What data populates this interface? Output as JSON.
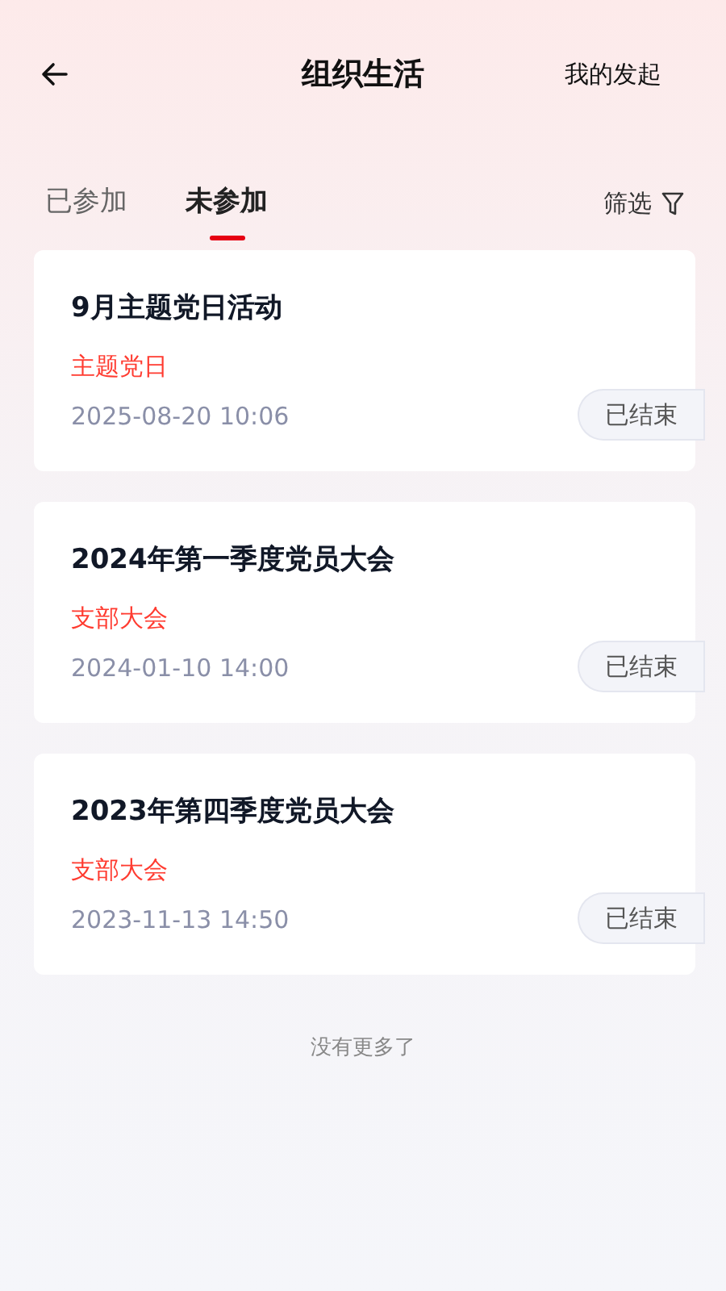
{
  "header": {
    "title": "组织生活",
    "action": "我的发起"
  },
  "tabs": [
    {
      "label": "已参加",
      "selected": false
    },
    {
      "label": "未参加",
      "selected": true
    }
  ],
  "filter": {
    "label": "筛选"
  },
  "events": [
    {
      "title": "9月主题党日活动",
      "type": "主题党日",
      "time": "2025-08-20 10:06",
      "status": "已结束"
    },
    {
      "title": "2024年第一季度党员大会",
      "type": "支部大会",
      "time": "2024-01-10 14:00",
      "status": "已结束"
    },
    {
      "title": "2023年第四季度党员大会",
      "type": "支部大会",
      "time": "2023-11-13 14:50",
      "status": "已结束"
    }
  ],
  "footer": "没有更多了"
}
